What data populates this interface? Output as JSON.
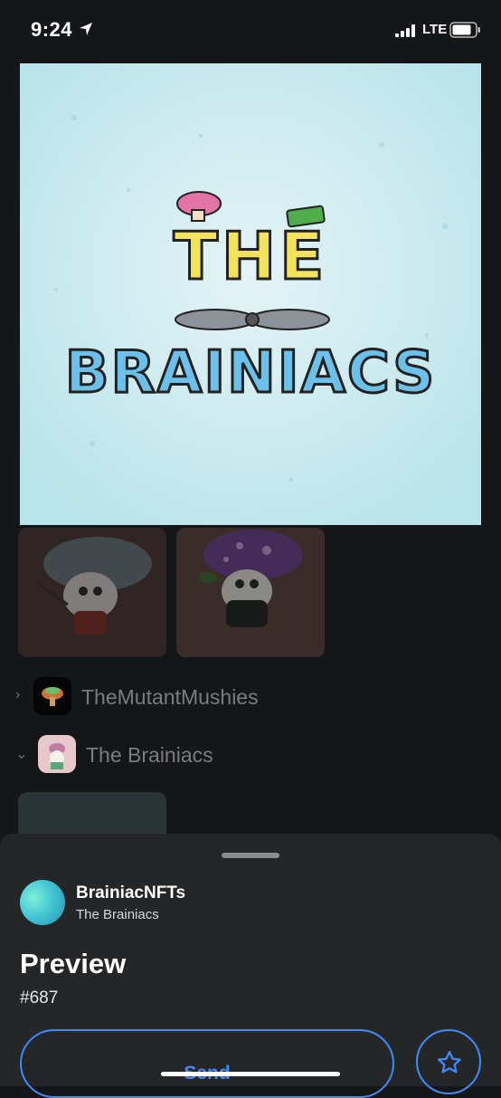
{
  "status_bar": {
    "time": "9:24",
    "network": "LTE"
  },
  "hero": {
    "title_line1": "THE",
    "title_line2": "BRAINIACS"
  },
  "collections": [
    {
      "name": "TheMutantMushies",
      "expanded": false
    },
    {
      "name": "The Brainiacs",
      "expanded": true
    }
  ],
  "sheet": {
    "collection_name": "BrainiacNFTs",
    "collection_subtitle": "The Brainiacs",
    "title": "Preview",
    "token_id": "#687",
    "send_label": "Send"
  },
  "colors": {
    "accent": "#3d8bfd",
    "background": "#151617",
    "sheet": "#242628"
  },
  "icons": [
    "location-arrow-icon",
    "signal-icon",
    "battery-icon",
    "chevron-right-icon",
    "chevron-down-icon",
    "star-icon"
  ]
}
